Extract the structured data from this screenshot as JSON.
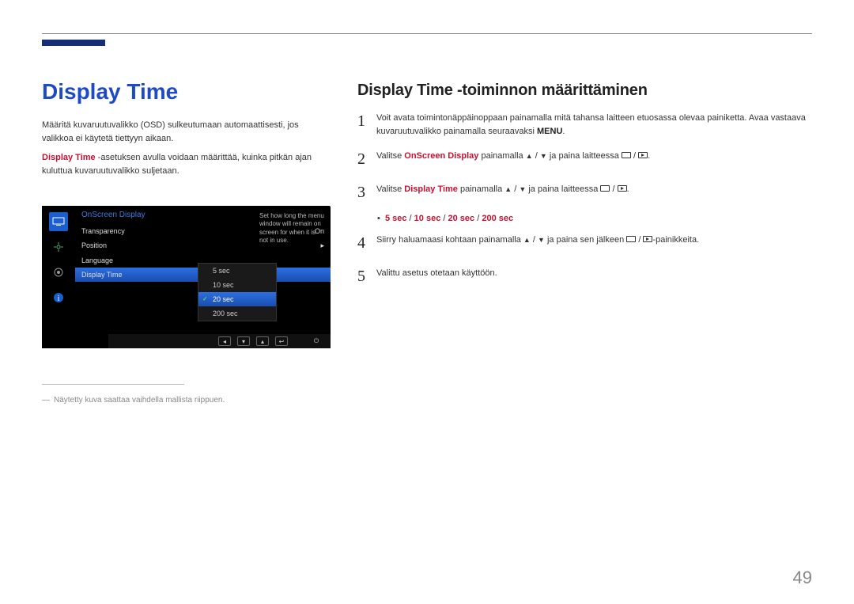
{
  "page_title": "Display Time",
  "intro_p1": "Määritä kuvaruutuvalikko (OSD) sulkeutumaan automaattisesti, jos valikkoa ei käytetä tiettyyn aikaan.",
  "intro_p2a": "Display Time",
  "intro_p2b": " -asetuksen avulla voidaan määrittää, kuinka pitkän ajan kuluttua kuvaruutuvalikko suljetaan.",
  "osd": {
    "header": "OnScreen Display",
    "rows": [
      {
        "label": "Transparency",
        "value": "On"
      },
      {
        "label": "Position",
        "value": "▸"
      },
      {
        "label": "Language",
        "value": ""
      },
      {
        "label": "Display Time",
        "value": ""
      }
    ],
    "hint": "Set how long the menu window will remain on screen for when it is not in use.",
    "popup": [
      "5 sec",
      "10 sec",
      "20 sec",
      "200 sec"
    ],
    "popup_sel": 2
  },
  "section_title": "Display Time -toiminnon määrittäminen",
  "steps": {
    "s1a": "Voit avata toimintonäppäinoppaan painamalla mitä tahansa laitteen etuosassa olevaa painiketta. Avaa vastaava kuvaruutuvalikko painamalla seuraavaksi ",
    "s1_menu": "MENU",
    "s2a": "Valitse ",
    "s2b": "OnScreen Display",
    "s2c": " painamalla ",
    "s2d": " ja paina laitteessa ",
    "s3a": "Valitse ",
    "s3b": "Display Time",
    "s3c": " painamalla ",
    "s3d": " ja paina laitteessa ",
    "options": [
      "5 sec",
      "10 sec",
      "20 sec",
      "200 sec"
    ],
    "s4a": "Siirry haluamaasi kohtaan painamalla ",
    "s4b": " ja paina sen jälkeen ",
    "s4c": "-painikkeita.",
    "s5": "Valittu asetus otetaan käyttöön."
  },
  "footnote_dash": "―",
  "footnote": "Näytetty kuva saattaa vaihdella mallista riippuen.",
  "page_number": "49"
}
